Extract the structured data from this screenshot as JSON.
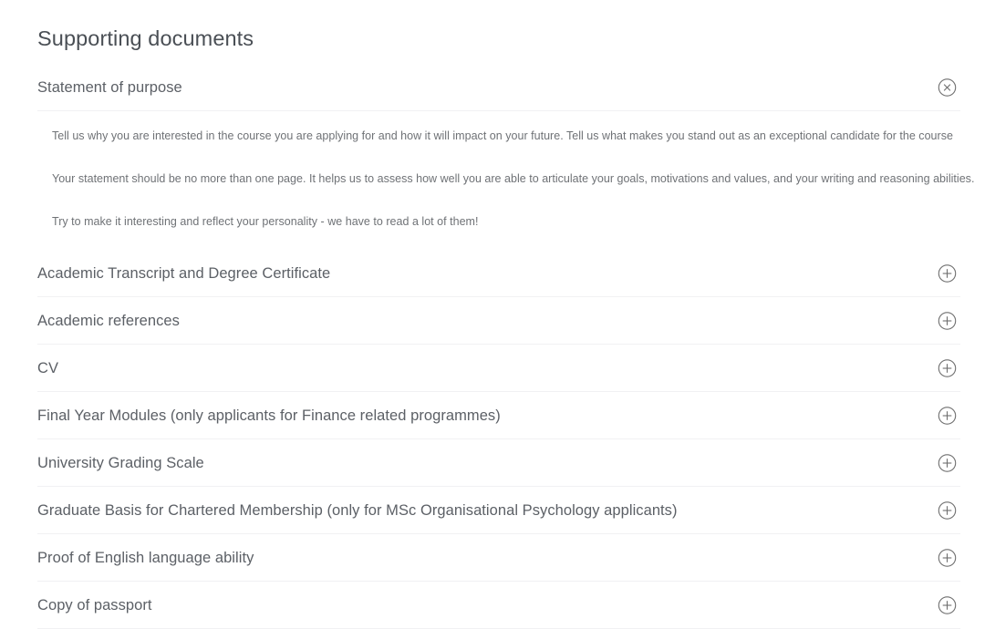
{
  "page": {
    "title": "Supporting documents"
  },
  "icons": {
    "expanded": "circle-close-icon",
    "collapsed": "circle-plus-icon"
  },
  "colors": {
    "heading_text": "#4a4f55",
    "row_text": "#5c6066",
    "body_text": "#6f7276",
    "divider": "#f1f1f3",
    "icon_stroke": "#6e6e6e",
    "background": "#ffffff"
  },
  "accordion": {
    "items": [
      {
        "label": "Statement of purpose",
        "expanded": true,
        "toggle_icon": "circle-close-icon",
        "paragraphs": [
          "Tell us why you are interested in the course you are applying for and how it will impact on your future. Tell us what makes you stand out as an exceptional candidate for the course",
          "Your statement should be no more than one page. It helps us to assess how well you are able to articulate your goals, motivations and values, and your writing and reasoning abilities.",
          "Try to make it interesting and reflect your personality - we have to read a lot of them!"
        ]
      },
      {
        "label": "Academic Transcript and Degree Certificate",
        "expanded": false,
        "toggle_icon": "circle-plus-icon",
        "paragraphs": []
      },
      {
        "label": "Academic references",
        "expanded": false,
        "toggle_icon": "circle-plus-icon",
        "paragraphs": []
      },
      {
        "label": "CV",
        "expanded": false,
        "toggle_icon": "circle-plus-icon",
        "paragraphs": []
      },
      {
        "label": "Final Year Modules (only applicants for Finance related programmes)",
        "expanded": false,
        "toggle_icon": "circle-plus-icon",
        "paragraphs": []
      },
      {
        "label": "University Grading Scale",
        "expanded": false,
        "toggle_icon": "circle-plus-icon",
        "paragraphs": []
      },
      {
        "label": "Graduate Basis for Chartered Membership (only for MSc Organisational Psychology applicants)",
        "expanded": false,
        "toggle_icon": "circle-plus-icon",
        "paragraphs": []
      },
      {
        "label": "Proof of English language ability",
        "expanded": false,
        "toggle_icon": "circle-plus-icon",
        "paragraphs": []
      },
      {
        "label": "Copy of passport",
        "expanded": false,
        "toggle_icon": "circle-plus-icon",
        "paragraphs": []
      }
    ]
  }
}
